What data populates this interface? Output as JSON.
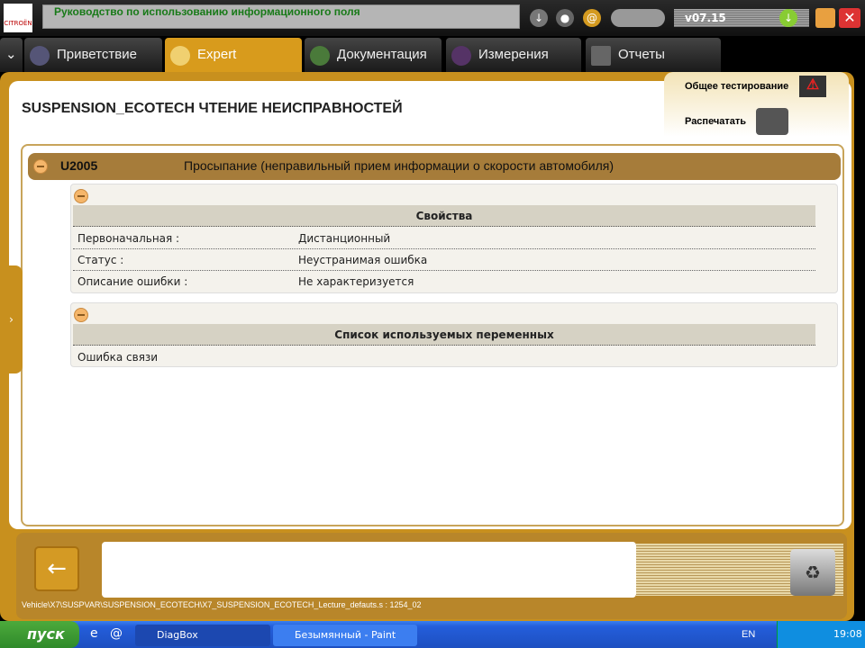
{
  "topbar": {
    "logo_text": "CITROËN",
    "info_text": "Руководство по использованию информационного поля",
    "version": "v07.15"
  },
  "tabs": [
    {
      "label": "Приветствие"
    },
    {
      "label": "Expert",
      "active": true
    },
    {
      "label": "Документация"
    },
    {
      "label": "Измерения"
    },
    {
      "label": "Отчеты"
    }
  ],
  "page": {
    "title": "SUSPENSION_ECOTECH  ЧТЕНИЕ НЕИСПРАВНОСТЕЙ"
  },
  "right_panel": {
    "general_test": "Общее тестирование",
    "print": "Распечатать"
  },
  "fault": {
    "code": "U2005",
    "description": "Просыпание (неправильный прием информации о скорости автомобиля)"
  },
  "properties": {
    "header": "Свойства",
    "rows": [
      {
        "label": "Первоначальная :",
        "value": "Дистанционный"
      },
      {
        "label": "Статус :",
        "value": "Неустранимая ошибка"
      },
      {
        "label": "Описание ошибки :",
        "value": "Не характеризуется"
      }
    ]
  },
  "variables": {
    "header": "Список используемых переменных",
    "rows": [
      "Ошибка связи"
    ]
  },
  "bottom": {
    "path": "Vehicle\\X7\\SUSPVAR\\SUSPENSION_ECOTECH\\X7_SUSPENSION_ECOTECH_Lecture_defauts.s : 1254_02"
  },
  "taskbar": {
    "start": "пуск",
    "tasks": [
      "DiagBox",
      "Безымянный - Paint"
    ],
    "lang": "EN",
    "time": "19:08"
  },
  "colors": {
    "accent": "#d89b1c",
    "fault_bar": "#a67c3a",
    "taskbar": "#245edb"
  }
}
